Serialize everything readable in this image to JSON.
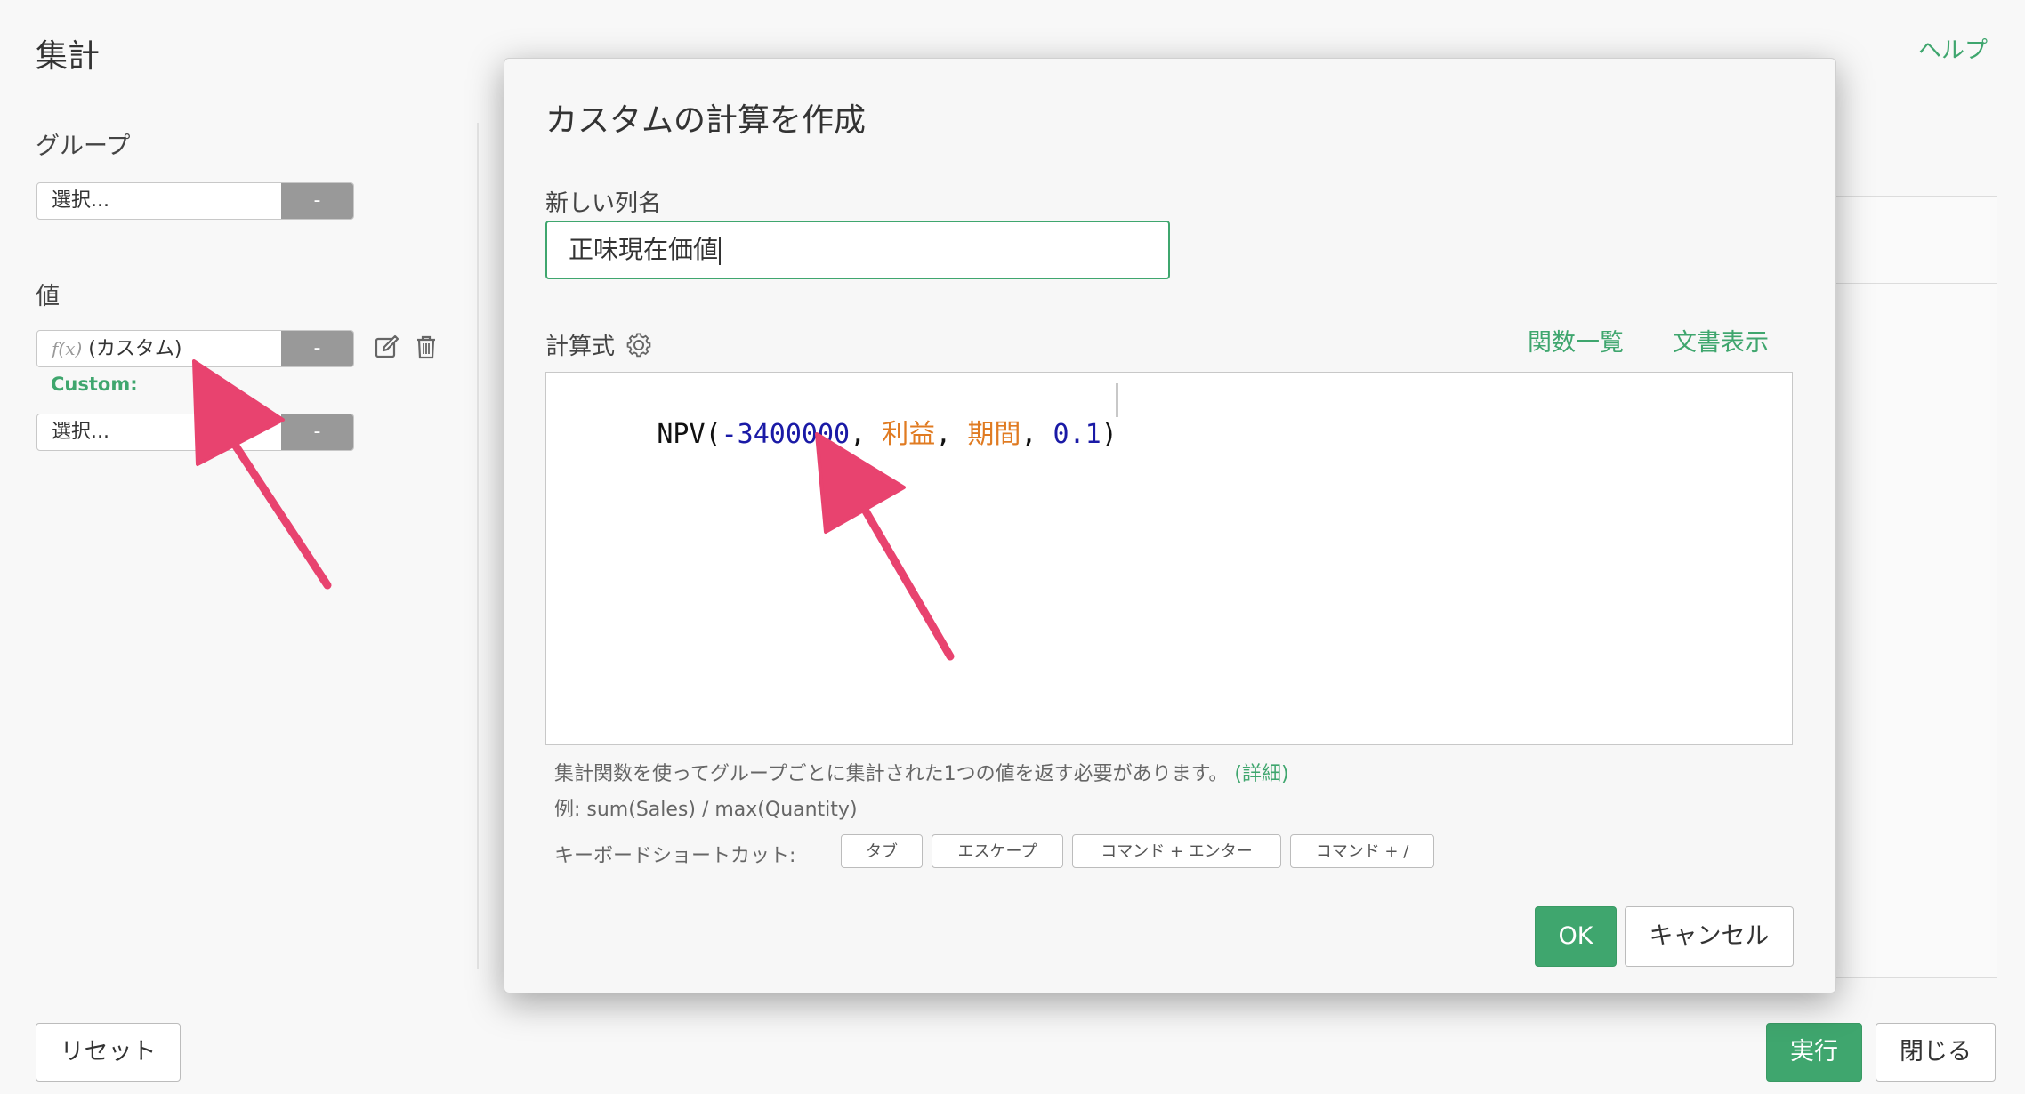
{
  "panel": {
    "title": "集計",
    "help": "ヘルプ",
    "group_label": "グループ",
    "group_select": "選択...",
    "group_btn": "-",
    "value_label": "値",
    "value_item": "(カスタム)",
    "value_fx": "f(x)",
    "value_btn": "-",
    "custom_label": "Custom:",
    "value_select2": "選択...",
    "value_btn2": "-",
    "reset": "リセット",
    "run": "実行",
    "close": "閉じる"
  },
  "modal": {
    "title": "カスタムの計算を作成",
    "name_label": "新しい列名",
    "name_value": "正味現在価値",
    "formula_label": "計算式",
    "functions_link": "関数一覧",
    "docs_link": "文書表示",
    "formula_tokens": [
      {
        "text": "NPV",
        "kind": "fn"
      },
      {
        "text": "(",
        "kind": "punct"
      },
      {
        "text": "-3400000",
        "kind": "num"
      },
      {
        "text": ", ",
        "kind": "punct"
      },
      {
        "text": "利益",
        "kind": "col"
      },
      {
        "text": ", ",
        "kind": "punct"
      },
      {
        "text": "期間",
        "kind": "col"
      },
      {
        "text": ", ",
        "kind": "punct"
      },
      {
        "text": "0.1",
        "kind": "num"
      },
      {
        "text": ")",
        "kind": "punct"
      }
    ],
    "hint_text": "集計関数を使ってグループごとに集計された1つの値を返す必要があります。",
    "hint_link": "(詳細)",
    "example": "例: sum(Sales) / max(Quantity)",
    "shortcut_label": "キーボードショートカット:",
    "shortcuts": [
      "タブ",
      "エスケープ",
      "コマンド + エンター",
      "コマンド + /"
    ],
    "ok": "OK",
    "cancel": "キャンセル"
  },
  "colors": {
    "accent": "#3fa66e",
    "arrow": "#e8436f",
    "number_token": "#1a1aa6",
    "column_token": "#e07b22"
  },
  "icons": [
    "edit-icon",
    "trash-icon",
    "gear-icon"
  ]
}
